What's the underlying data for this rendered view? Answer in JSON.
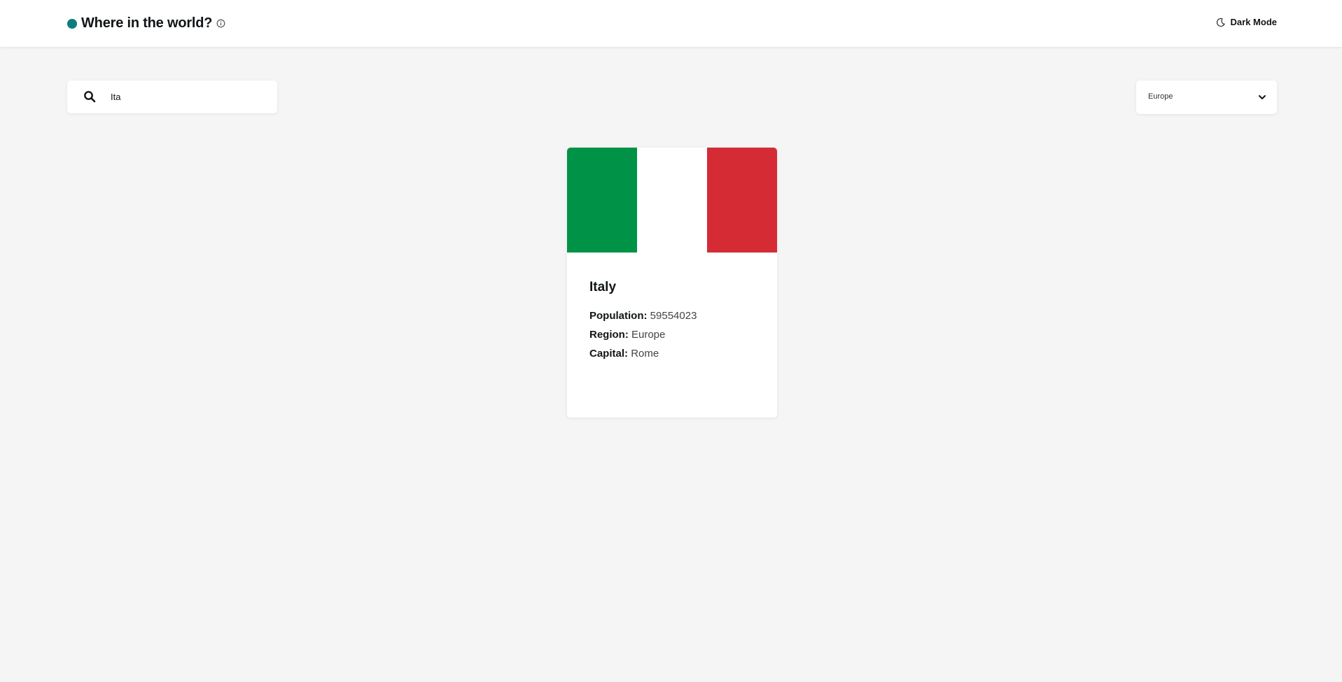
{
  "header": {
    "title": "Where in the world?",
    "theme_toggle_label": "Dark Mode",
    "brand_color": "#0e7c7b",
    "icons": [
      "info-icon",
      "moon-icon"
    ]
  },
  "search": {
    "value": "Ita",
    "icon": "search-icon"
  },
  "filter": {
    "selected": "Europe",
    "icon": "chevron-down-icon"
  },
  "countries": [
    {
      "name": "Italy",
      "flag_colors": [
        "#009246",
        "#ffffff",
        "#d52b35"
      ],
      "population_label": "Population:",
      "population": "59554023",
      "region_label": "Region:",
      "region": "Europe",
      "capital_label": "Capital:",
      "capital": "Rome"
    }
  ]
}
